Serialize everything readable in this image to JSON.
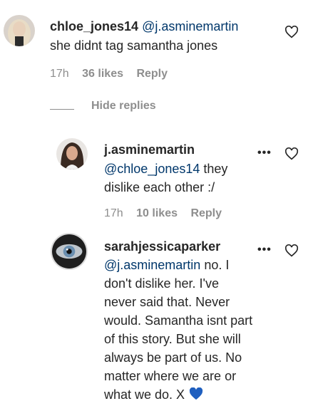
{
  "comments": [
    {
      "username": "chloe_jones14",
      "mention": "@j.asminemartin",
      "lines": [
        "she didnt tag samantha jones"
      ],
      "time": "17h",
      "likes": "36 likes",
      "reply": "Reply",
      "avatar": "blonde-woman-avatar"
    },
    {
      "username": "j.asminemartin",
      "mention": "@chloe_jones14",
      "first_line_rest": " they",
      "lines": [
        "dislike each other :/"
      ],
      "time": "17h",
      "likes": "10 likes",
      "reply": "Reply",
      "avatar": "brunette-woman-avatar"
    },
    {
      "username": "sarahjessicaparker",
      "mention": "@j.asminemartin",
      "first_line_rest": " no. I",
      "lines": [
        "don't dislike her. I've",
        "never said that. Never",
        "would. Samantha isnt part",
        "of this story. But she will",
        "always be part of us. No",
        "matter where we are or",
        "what we do. X"
      ],
      "emoji": "blue-heart",
      "avatar": "eye-avatar"
    }
  ],
  "hide_replies": "Hide replies",
  "more_label": "•••",
  "icons": {
    "like": "heart-outline-icon",
    "more": "more-options-icon"
  },
  "colors": {
    "text": "#262626",
    "muted": "#8e8e8e",
    "mention": "#00376b",
    "blue_heart": "#1f5fbf"
  }
}
